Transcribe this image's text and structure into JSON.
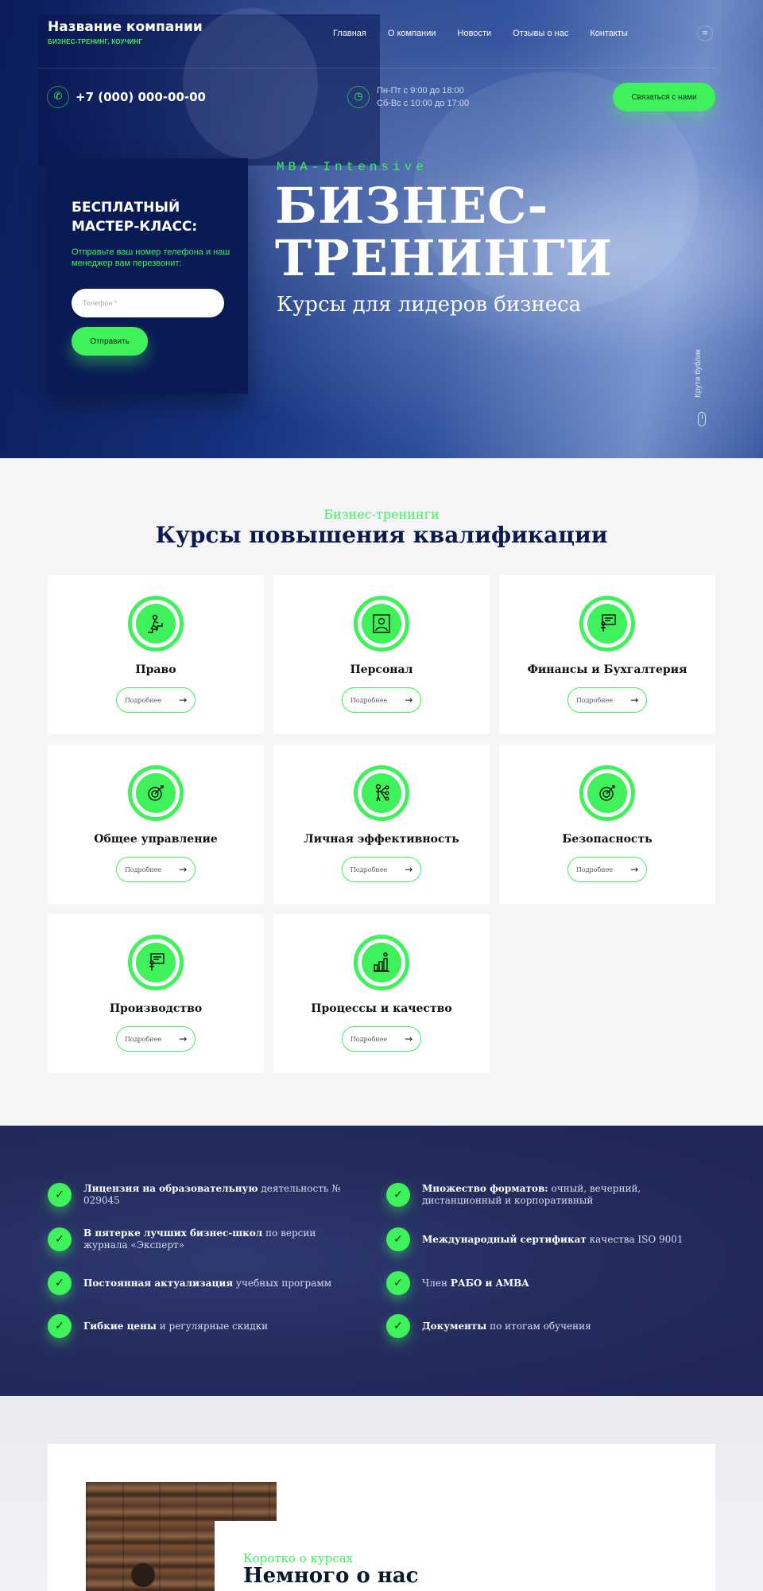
{
  "header": {
    "company_name": "Название компании",
    "tagline": "БИЗНЕС-ТРЕНИНГ, КОУЧИНГ",
    "nav": [
      "Главная",
      "О компании",
      "Новости",
      "Отзывы о нас",
      "Контакты"
    ],
    "menu_icon": "≡",
    "phone": "+7 (000) 000-00-00",
    "hours_weekdays": "Пн-Пт с 9:00 до 18:00",
    "hours_weekend": "Сб-Вс с 10:00 до 17:00",
    "contact_button": "Связаться с нами",
    "phone_icon": "✆",
    "clock_icon": "◷"
  },
  "lead_form": {
    "title": "БЕСПЛАТНЫЙ МАСТЕР-КЛАСС:",
    "text": "Отправьте ваш номер телефона и наш менеджер вам перезвонит:",
    "phone_placeholder": "Телефон *",
    "submit_label": "Отправить"
  },
  "hero": {
    "kicker": "MBA-Intensive",
    "title": "БИЗНЕС-ТРЕНИНГИ",
    "subtitle": "Курсы для лидеров бизнеса",
    "scroll_hint": "Крути бублик"
  },
  "courses": {
    "kicker": "Бизнес-тренинги",
    "title": "Курсы повышения квалификации",
    "more_label": "Подробнее",
    "items": [
      {
        "title": "Право",
        "icon": "climbing-stairs-icon"
      },
      {
        "title": "Персонал",
        "icon": "person-icon"
      },
      {
        "title": "Финансы и Бухгалтерия",
        "icon": "presentation-icon"
      },
      {
        "title": "Общее управление",
        "icon": "target-icon"
      },
      {
        "title": "Личная эффективность",
        "icon": "network-person-icon"
      },
      {
        "title": "Безопасность",
        "icon": "target-icon"
      },
      {
        "title": "Производство",
        "icon": "presentation-icon"
      },
      {
        "title": "Процессы и качество",
        "icon": "growth-chart-icon"
      }
    ]
  },
  "features": {
    "left": [
      {
        "bold": "Лицензия на образовательную",
        "rest": " деятельность № 029045"
      },
      {
        "bold": "В пятерке лучших бизнес-школ",
        "rest": " по версии журнала «Эксперт»"
      },
      {
        "bold": "Постоянная актуализация",
        "rest": " учебных программ"
      },
      {
        "bold": "Гибкие цены",
        "rest": " и регулярные скидки"
      }
    ],
    "right": [
      {
        "bold": "Множество форматов:",
        "rest": " очный, вечерний, дистанционный и корпоративный"
      },
      {
        "bold": "Международный сертификат",
        "rest": " качества ISO 9001"
      },
      {
        "pre": "Член ",
        "bold": "РАБО и AMBA",
        "rest": ""
      },
      {
        "bold": "Документы",
        "rest": " по итогам обучения"
      }
    ],
    "check_icon": "✓"
  },
  "about": {
    "kicker": "Коротко о курсах",
    "title": "Немного о нас"
  },
  "colors": {
    "accent": "#3ff15a",
    "navy": "#0a1a55",
    "features_bg": "#252d5f"
  }
}
